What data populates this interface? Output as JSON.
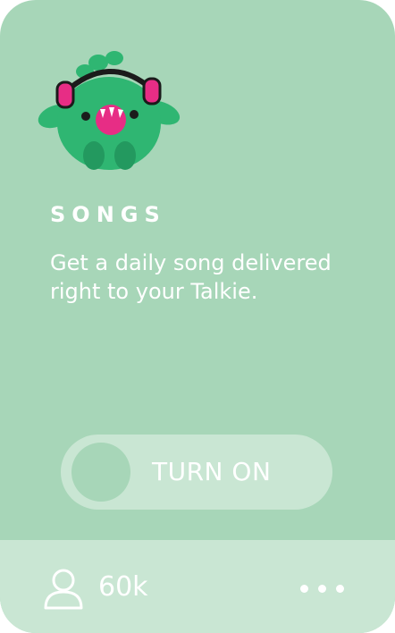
{
  "card": {
    "title": "SONGS",
    "description": "Get a daily song delivered right to your Talkie."
  },
  "toggle": {
    "label": "TURN ON"
  },
  "footer": {
    "followers_icon": "user-icon",
    "followers_count": "60k",
    "more_icon": "more-dots-icon"
  },
  "colors": {
    "card_bg": "#a7d6b8",
    "footer_bg": "#c9e6d3",
    "mascot_green": "#2fb672",
    "mascot_pink": "#e72d85"
  }
}
